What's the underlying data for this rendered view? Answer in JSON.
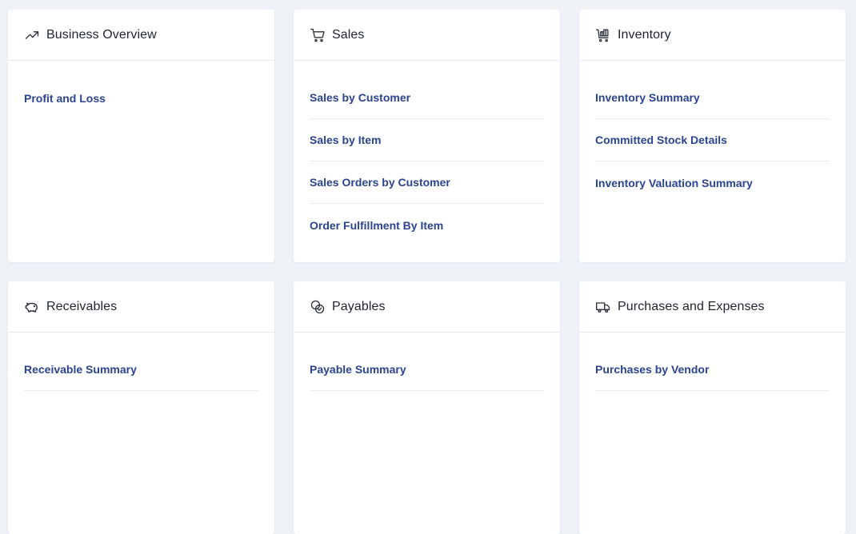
{
  "cards": [
    {
      "title": "Business Overview",
      "icon": "trending-up-icon",
      "reports": [
        "Profit and Loss"
      ]
    },
    {
      "title": "Sales",
      "icon": "shopping-cart-icon",
      "reports": [
        "Sales by Customer",
        "Sales by Item",
        "Sales Orders by Customer",
        "Order Fulfillment By Item"
      ]
    },
    {
      "title": "Inventory",
      "icon": "inventory-cart-icon",
      "reports": [
        "Inventory Summary",
        "Committed Stock Details",
        "Inventory Valuation Summary"
      ]
    },
    {
      "title": "Receivables",
      "icon": "piggy-bank-icon",
      "reports": [
        "Receivable Summary"
      ]
    },
    {
      "title": "Payables",
      "icon": "coins-icon",
      "reports": [
        "Payable Summary"
      ]
    },
    {
      "title": "Purchases and Expenses",
      "icon": "truck-icon",
      "reports": [
        "Purchases by Vendor"
      ]
    }
  ],
  "colors": {
    "background": "#eef1f6",
    "link": "#2a4491",
    "title": "#1f2430"
  }
}
